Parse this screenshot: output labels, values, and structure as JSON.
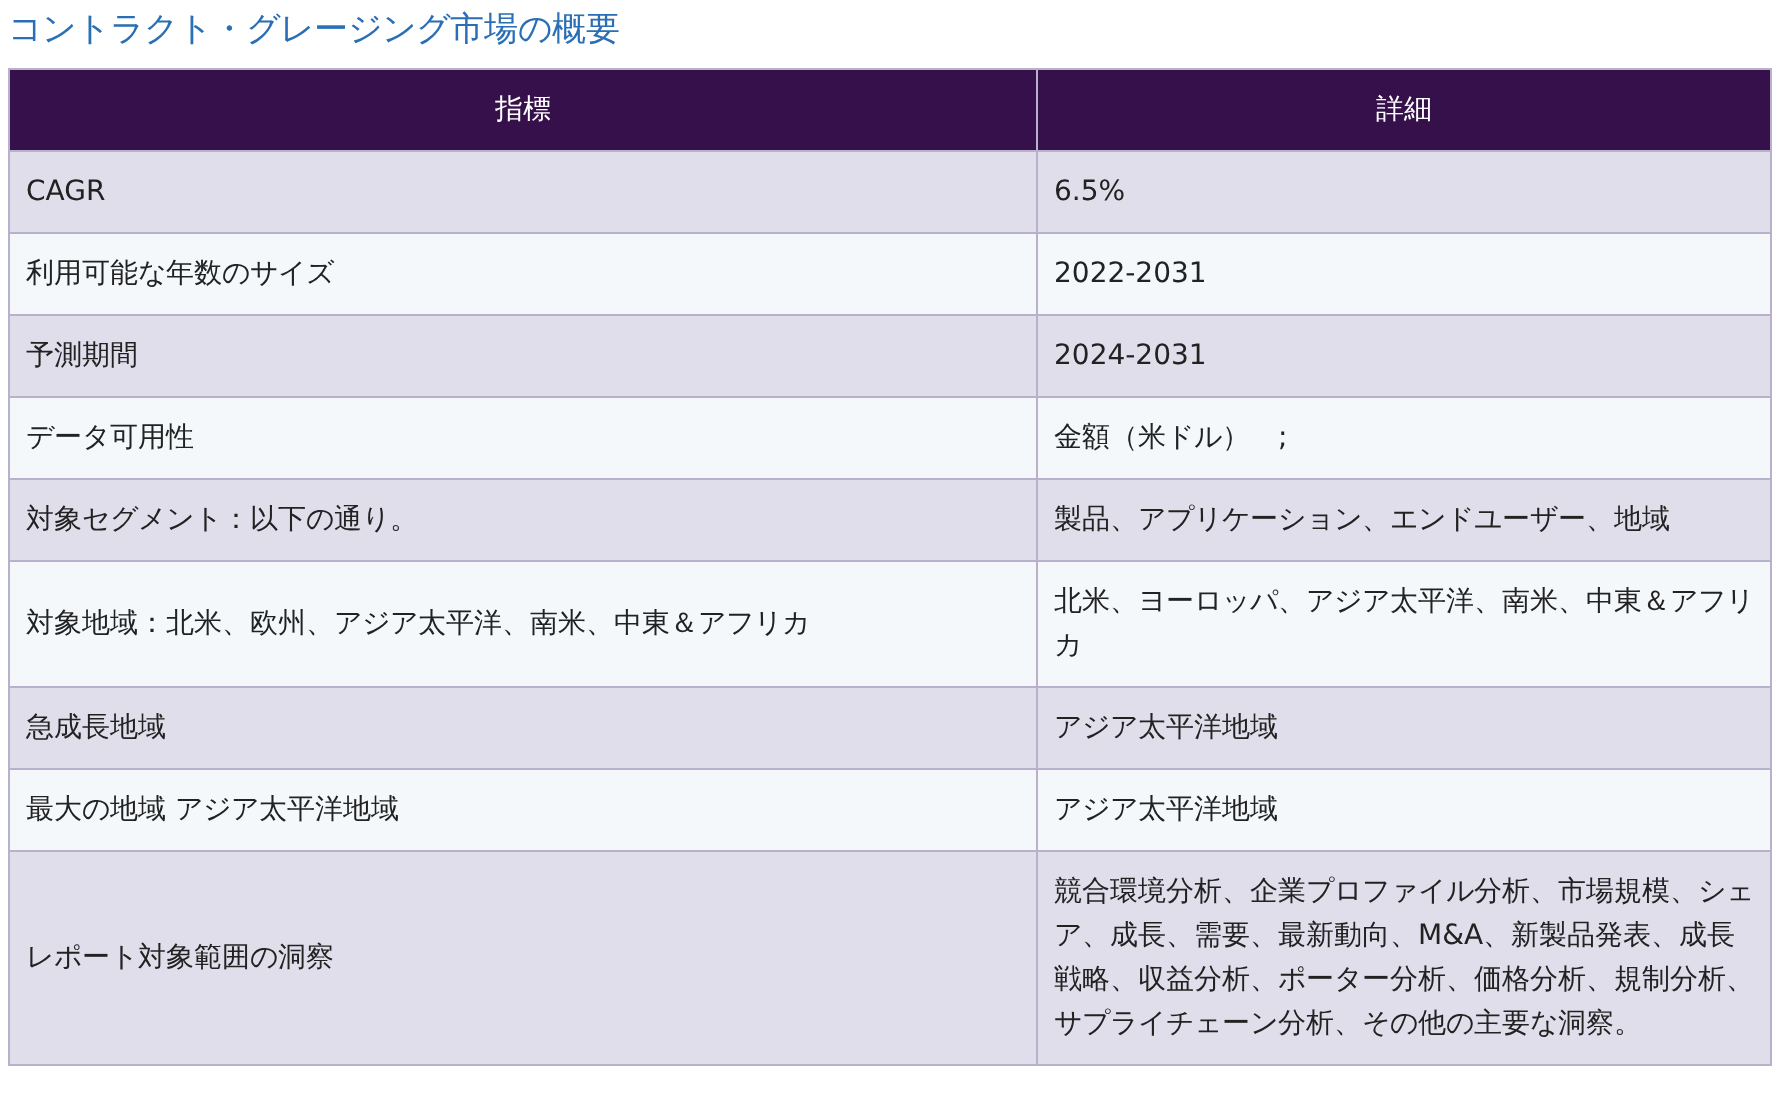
{
  "title": "コントラクト・グレージング市場の概要",
  "table": {
    "columns": [
      "指標",
      "詳細"
    ],
    "rows": [
      [
        "CAGR",
        "6.5%"
      ],
      [
        "利用可能な年数のサイズ",
        "2022-2031"
      ],
      [
        "予測期間",
        "2024-2031"
      ],
      [
        "データ可用性",
        "金額（米ドル）　;"
      ],
      [
        "対象セグメント：以下の通り。",
        "製品、アプリケーション、エンドユーザー、地域"
      ],
      [
        "対象地域：北米、欧州、アジア太平洋、南米、中東＆アフリカ",
        "北米、ヨーロッパ、アジア太平洋、南米、中東＆アフリカ"
      ],
      [
        "急成長地域",
        "アジア太平洋地域"
      ],
      [
        "最大の地域 アジア太平洋地域",
        "アジア太平洋地域"
      ],
      [
        "レポート対象範囲の洞察",
        "競合環境分析、企業プロファイル分析、市場規模、シェア、成長、需要、最新動向、M&A、新製品発表、成長戦略、収益分析、ポーター分析、価格分析、規制分析、サプライチェーン分析、その他の主要な洞察。"
      ]
    ]
  }
}
